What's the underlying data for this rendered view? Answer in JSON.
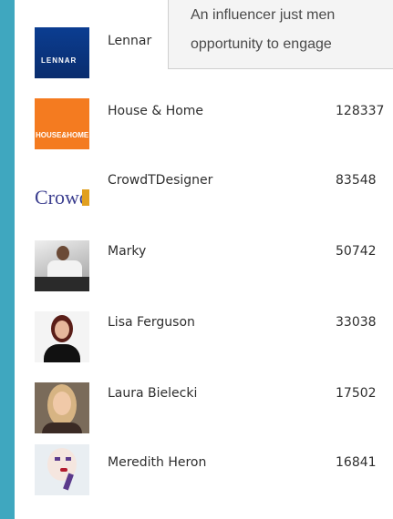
{
  "tooltip": {
    "line1": "An influencer just men",
    "line2": "opportunity to engage"
  },
  "rows": [
    {
      "name": "Lennar",
      "count": "",
      "logo": "lennar-logo",
      "logo_text": "LENNAR"
    },
    {
      "name": "House & Home",
      "count": "128337",
      "logo": "house-and-home-logo",
      "logo_text": "HOUSE&HOME"
    },
    {
      "name": "CrowdTDesigner",
      "count": "83548",
      "logo": "crowdtdesigner-logo",
      "logo_text": "Crowd"
    },
    {
      "name": "Marky",
      "count": "50742",
      "logo": "person-avatar"
    },
    {
      "name": "Lisa Ferguson",
      "count": "33038",
      "logo": "person-avatar"
    },
    {
      "name": "Laura Bielecki",
      "count": "17502",
      "logo": "person-avatar"
    },
    {
      "name": "Meredith Heron",
      "count": "16841",
      "logo": "person-avatar"
    }
  ],
  "colors": {
    "accent_border": "#3fa7bf",
    "tooltip_bg": "#f4f4f4"
  }
}
